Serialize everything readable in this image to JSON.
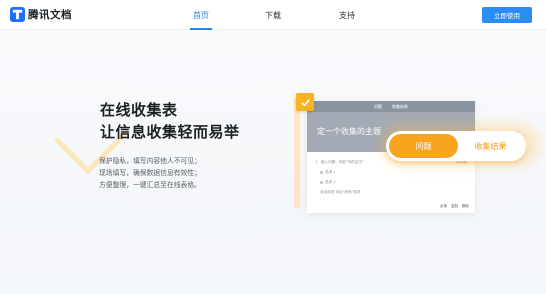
{
  "header": {
    "logo_text": "腾讯文档",
    "nav": [
      {
        "label": "首页",
        "active": true
      },
      {
        "label": "下载",
        "active": false
      },
      {
        "label": "支持",
        "active": false
      }
    ],
    "cta_label": "立即使用"
  },
  "hero": {
    "headline_1": "在线收集表",
    "headline_2": "让信息收集轻而易举",
    "desc_1": "保护隐私，填写内容他人不可见；",
    "desc_2": "现场填写，确保数据信息有效性；",
    "desc_3": "方便整理，一键汇总至在线表格。"
  },
  "mockup": {
    "top_tabs": [
      "问题",
      "收集结果"
    ],
    "banner_title": "定一个收集的主题",
    "question": "1、输入问题，例如\"你的名字\"",
    "question_type": "单选题",
    "options": [
      "选项 1",
      "选项 2"
    ],
    "add_option": "添加选项 添加\"其他\"选项",
    "footer": [
      "必填",
      "复制",
      "删除"
    ]
  },
  "toggle": {
    "active_label": "问题",
    "inactive_label": "收集结果"
  },
  "colors": {
    "accent_blue": "#2a82f0",
    "accent_orange": "#f7a51f"
  }
}
